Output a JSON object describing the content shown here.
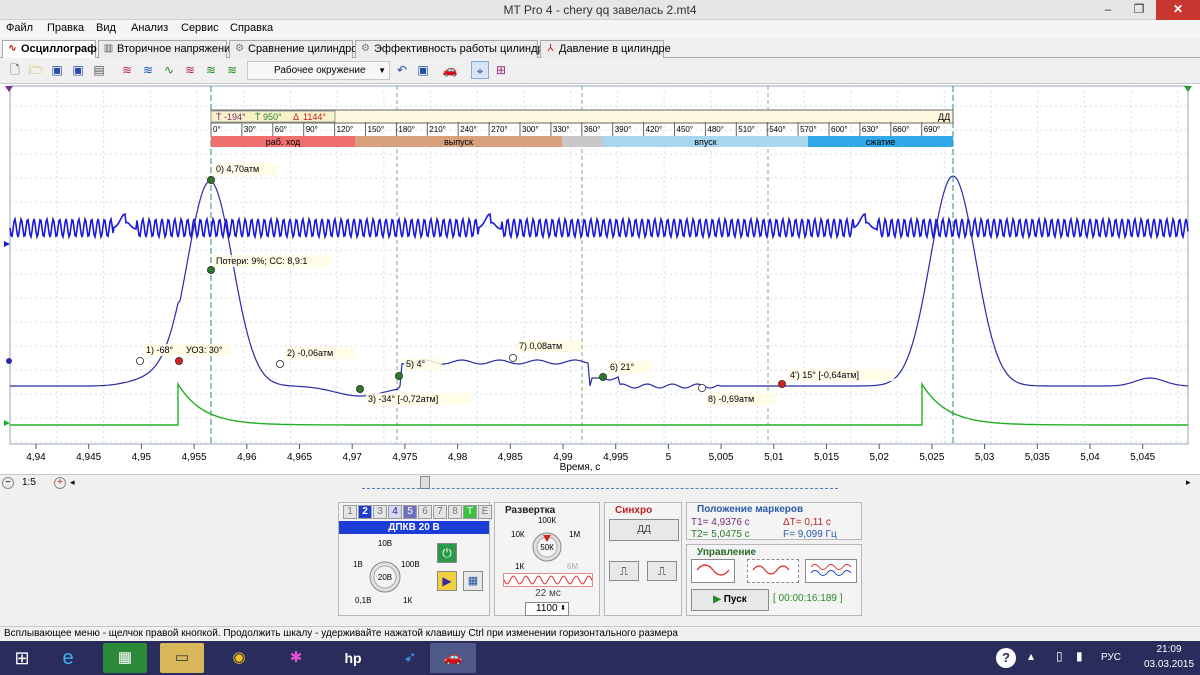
{
  "window": {
    "title": "MT Pro 4 - chery qq завелась 2.mt4",
    "minimize": "–",
    "maximize": "❐",
    "close": "✕"
  },
  "menu": [
    "Файл",
    "Правка",
    "Вид",
    "Анализ",
    "Сервис",
    "Справка"
  ],
  "tabs": [
    {
      "label": "Осциллограф",
      "icon": "wave-icon",
      "active": true
    },
    {
      "label": "Вторичное напряжение",
      "icon": "secondary-voltage-icon"
    },
    {
      "label": "Сравнение цилиндров",
      "icon": "cylinder-compare-icon"
    },
    {
      "label": "Эффективность работы цилиндров",
      "icon": "cylinder-efficiency-icon"
    },
    {
      "label": "Давление в цилиндре",
      "icon": "pressure-icon"
    }
  ],
  "toolbar": {
    "workspace": "Рабочее окружение"
  },
  "plot": {
    "degree_strip": {
      "t1": "-194°",
      "t2": "950°",
      "delta": "1144°",
      "sync": "ДД",
      "ticks": [
        "0°",
        "30°",
        "60°",
        "90°",
        "120°",
        "150°",
        "180°",
        "210°",
        "240°",
        "270°",
        "300°",
        "330°",
        "360°",
        "390°",
        "420°",
        "450°",
        "480°",
        "510°",
        "540°",
        "570°",
        "600°",
        "630°",
        "660°",
        "690°"
      ],
      "phases": [
        {
          "label": "раб. ход",
          "color": "#f07070"
        },
        {
          "label": "выпуск",
          "color": "#d9a07c"
        },
        {
          "label": "",
          "color": "#c8c8c8"
        },
        {
          "label": "впуск",
          "color": "#a8d8f0"
        },
        {
          "label": "сжатие",
          "color": "#30a8e8"
        }
      ]
    },
    "markers": [
      {
        "label": "0)  4,70атм",
        "color": "#2a7a2a"
      },
      {
        "label": "Потери: 9%; СС: 8,9:1",
        "color": "#2a7a2a"
      },
      {
        "label": "1)  -68°",
        "color": "#ffffff"
      },
      {
        "label": "УОЗ: 30°",
        "color": "#d82020"
      },
      {
        "label": "2)  -0,06атм",
        "color": "#ffffff"
      },
      {
        "label": "3)  -34° [-0,72атм]",
        "color": "#2a7a2a"
      },
      {
        "label": "5)  4°",
        "color": "#2a7a2a"
      },
      {
        "label": "7)  0,08атм",
        "color": "#ffffff"
      },
      {
        "label": "6)  21°",
        "color": "#2a7a2a"
      },
      {
        "label": "8)  -0,69атм",
        "color": "#ffffff"
      },
      {
        "label": "4')  15° [-0,64атм]",
        "color": "#d82020"
      }
    ],
    "x_ticks": [
      "4,94",
      "4,945",
      "4,95",
      "4,955",
      "4,96",
      "4,965",
      "4,97",
      "4,975",
      "4,98",
      "4,985",
      "4,99",
      "4,995",
      "5",
      "5,005",
      "5,01",
      "5,015",
      "5,02",
      "5,025",
      "5,03",
      "5,035",
      "5,04",
      "5,045"
    ],
    "x_label": "Время, с",
    "zoom": "1:5"
  },
  "channel": {
    "numbers": [
      "1",
      "2",
      "3",
      "4",
      "5",
      "6",
      "7",
      "8",
      "T",
      "E"
    ],
    "selected": "2",
    "sensor": "ДПКВ 20 В",
    "range_labels": {
      "top": "10В",
      "left": "1В",
      "right": "100В",
      "center": "20В",
      "bl": "0,1В",
      "br": "1К"
    }
  },
  "sweep": {
    "title": "Развертка",
    "labels": {
      "top": "100К",
      "tl": "10К",
      "tr": "1М",
      "center": "50К",
      "bl": "1К",
      "br": "6М"
    },
    "time": "22 мс",
    "samples": "1100"
  },
  "sync": {
    "title": "Синхро",
    "mode": "ДД"
  },
  "markers_panel": {
    "title": "Положение маркеров",
    "t1": "T1= 4,9376 с",
    "dt": "ΔT= 0,11 с",
    "t2": "T2= 5,0475 с",
    "f": "F= 9,099 Гц"
  },
  "control": {
    "title": "Управление",
    "start": "Пуск",
    "timer": "[ 00:00:16:189 ]"
  },
  "status": "Всплывающее меню - щелчок правой кнопкой. Продолжить шкалу - удерживайте нажатой клавишу Ctrl при изменении горизонтального размера",
  "tray": {
    "lang": "РУС",
    "time": "21:09",
    "date": "03.03.2015"
  },
  "colors": {
    "pressure": "#2a2aa8",
    "ckp": "#1a1ad8",
    "ign": "#22b022",
    "grid": "#cfd8e8"
  }
}
